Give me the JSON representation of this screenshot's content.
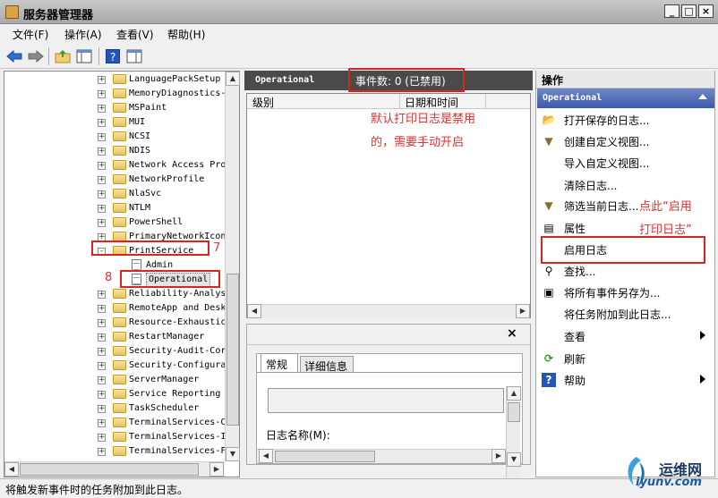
{
  "window": {
    "title": "服务器管理器",
    "controls": [
      "_",
      "□",
      "×"
    ]
  },
  "menu": [
    {
      "label": "文件(F)"
    },
    {
      "label": "操作(A)"
    },
    {
      "label": "查看(V)"
    },
    {
      "label": "帮助(H)"
    }
  ],
  "tree": {
    "items": [
      {
        "label": "LanguagePackSetup",
        "level": 1,
        "expander": "+"
      },
      {
        "label": "MemoryDiagnostics-",
        "level": 1,
        "expander": "+"
      },
      {
        "label": "MSPaint",
        "level": 1,
        "expander": "+"
      },
      {
        "label": "MUI",
        "level": 1,
        "expander": "+"
      },
      {
        "label": "NCSI",
        "level": 1,
        "expander": "+"
      },
      {
        "label": "NDIS",
        "level": 1,
        "expander": "+"
      },
      {
        "label": "Network Access Pro",
        "level": 1,
        "expander": "+"
      },
      {
        "label": "NetworkProfile",
        "level": 1,
        "expander": "+"
      },
      {
        "label": "NlaSvc",
        "level": 1,
        "expander": "+"
      },
      {
        "label": "NTLM",
        "level": 1,
        "expander": "+"
      },
      {
        "label": "PowerShell",
        "level": 1,
        "expander": "+"
      },
      {
        "label": "PrimaryNetworkIcon",
        "level": 1,
        "expander": "+"
      },
      {
        "label": "PrintService",
        "level": 1,
        "expander": "-"
      },
      {
        "label": "Admin",
        "level": 2,
        "expander": ""
      },
      {
        "label": "Operational",
        "level": 2,
        "expander": "",
        "selected": true
      },
      {
        "label": "Reliability-Analys",
        "level": 1,
        "expander": "+"
      },
      {
        "label": "RemoteApp and Desk",
        "level": 1,
        "expander": "+"
      },
      {
        "label": "Resource-Exhaustic",
        "level": 1,
        "expander": "+"
      },
      {
        "label": "RestartManager",
        "level": 1,
        "expander": "+"
      },
      {
        "label": "Security-Audit-Cor",
        "level": 1,
        "expander": "+"
      },
      {
        "label": "Security-Configura",
        "level": 1,
        "expander": "+"
      },
      {
        "label": "ServerManager",
        "level": 1,
        "expander": "+"
      },
      {
        "label": "Service Reporting",
        "level": 1,
        "expander": "+"
      },
      {
        "label": "TaskScheduler",
        "level": 1,
        "expander": "+"
      },
      {
        "label": "TerminalServices-C",
        "level": 1,
        "expander": "+"
      },
      {
        "label": "TerminalServices-I",
        "level": 1,
        "expander": "+"
      },
      {
        "label": "TerminalServices-F",
        "level": 1,
        "expander": "+"
      }
    ]
  },
  "center": {
    "title": "Operational",
    "event_count": "事件数: 0 (已禁用)",
    "columns": [
      "级别",
      "日期和时间"
    ],
    "details": {
      "tabs": [
        "常规",
        "详细信息"
      ],
      "field_label": "日志名称(M):"
    }
  },
  "actions": {
    "header": "操作",
    "section": "Operational",
    "items": [
      {
        "label": "打开保存的日志...",
        "icon": "folder-open-icon",
        "glyph": "📂"
      },
      {
        "label": "创建自定义视图...",
        "icon": "filter-icon",
        "glyph": "▼"
      },
      {
        "label": "导入自定义视图...",
        "icon": "",
        "glyph": ""
      },
      {
        "label": "清除日志...",
        "icon": "",
        "glyph": ""
      },
      {
        "label": "筛选当前日志...",
        "icon": "filter-icon",
        "glyph": "▼"
      },
      {
        "label": "属性",
        "icon": "properties-icon",
        "glyph": "▤"
      },
      {
        "label": "启用日志",
        "icon": "",
        "glyph": ""
      },
      {
        "label": "查找...",
        "icon": "find-icon",
        "glyph": "⚲"
      },
      {
        "label": "将所有事件另存为...",
        "icon": "save-icon",
        "glyph": "▣"
      },
      {
        "label": "将任务附加到此日志...",
        "icon": "",
        "glyph": ""
      },
      {
        "label": "查看",
        "icon": "",
        "glyph": "",
        "submenu": true
      },
      {
        "label": "刷新",
        "icon": "refresh-icon",
        "glyph": "⟳"
      },
      {
        "label": "帮助",
        "icon": "help-icon",
        "glyph": "?",
        "submenu": true
      }
    ]
  },
  "status": {
    "text": "将触发新事件时的任务附加到此日志。"
  },
  "annotations": {
    "note_center_1": "默认打印日志是禁用",
    "note_center_2": "的，需要手动开启",
    "note_right_1": "点此“启用",
    "note_right_2": "打印日志”",
    "step7": "7",
    "step8": "8"
  },
  "watermark": {
    "line1": "运维网",
    "line2": "iyunv.com"
  },
  "colors": {
    "accent_red": "#d22222",
    "section_blue": "#3b59a8",
    "header_dark": "#4a4a4a"
  }
}
